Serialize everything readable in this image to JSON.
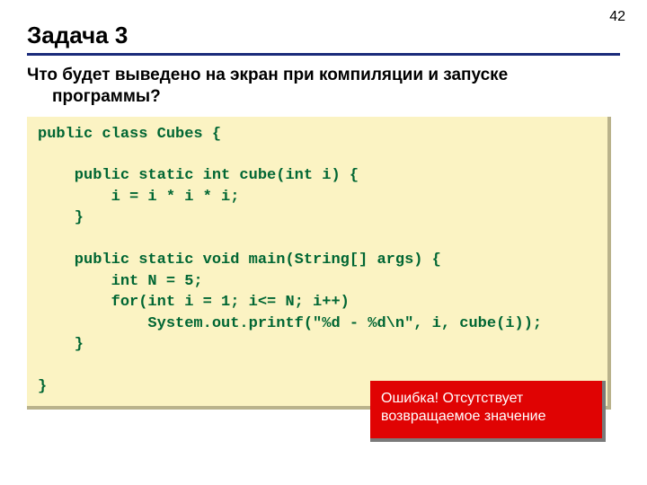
{
  "page_number": "42",
  "title": "Задача 3",
  "question_line1": "Что будет выведено на экран при компиляции и запуске",
  "question_line2": "программы?",
  "code": "public class Cubes {\n\n    public static int cube(int i) {\n        i = i * i * i;\n    }\n\n    public static void main(String[] args) {\n        int N = 5;\n        for(int i = 1; i<= N; i++)\n            System.out.printf(\"%d - %d\\n\", i, cube(i));\n    }\n\n}",
  "error_text": "Ошибка! Отсутствует возвращаемое значение"
}
